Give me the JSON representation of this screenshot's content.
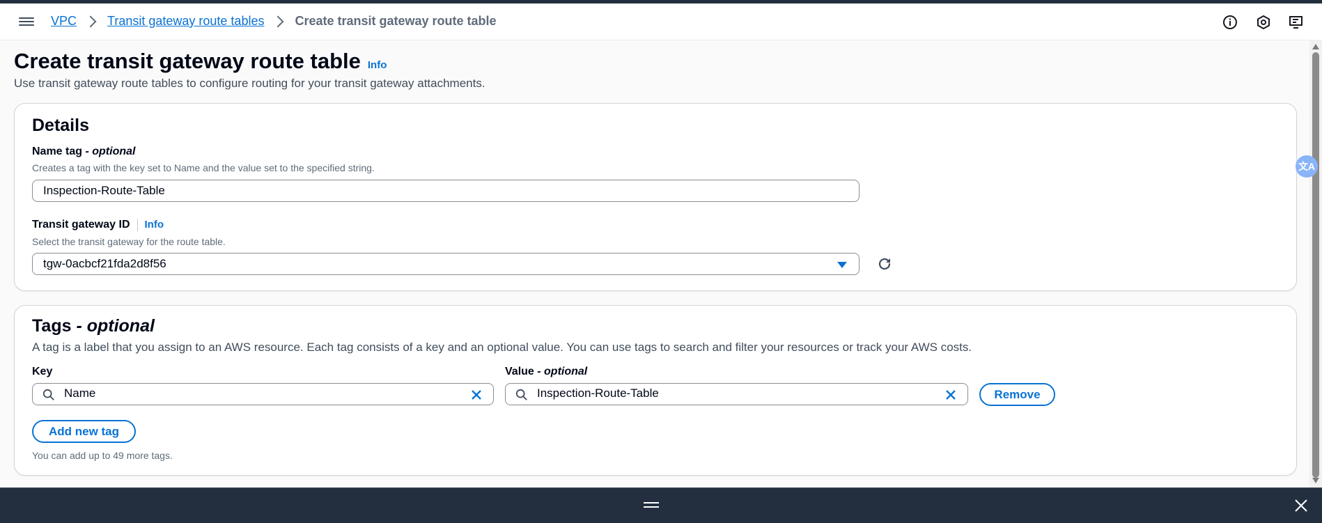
{
  "breadcrumbs": [
    {
      "label": "VPC"
    },
    {
      "label": "Transit gateway route tables"
    }
  ],
  "breadcrumb_current": "Create transit gateway route table",
  "page": {
    "title": "Create transit gateway route table",
    "info": "Info",
    "description": "Use transit gateway route tables to configure routing for your transit gateway attachments."
  },
  "details": {
    "title": "Details",
    "name_tag": {
      "label": "Name tag",
      "label_suffix": " - optional",
      "hint": "Creates a tag with the key set to Name and the value set to the specified string.",
      "value": "Inspection-Route-Table"
    },
    "transit_gateway": {
      "label": "Transit gateway ID",
      "info": "Info",
      "hint": "Select the transit gateway for the route table.",
      "value": "tgw-0acbcf21fda2d8f56"
    }
  },
  "tags": {
    "title": "Tags",
    "title_suffix": " - optional",
    "description": "A tag is a label that you assign to an AWS resource. Each tag consists of a key and an optional value. You can use tags to search and filter your resources or track your AWS costs.",
    "key_label": "Key",
    "value_label": "Value",
    "value_label_suffix": " - optional",
    "rows": [
      {
        "key": "Name",
        "value": "Inspection-Route-Table",
        "remove_label": "Remove"
      }
    ],
    "add_label": "Add new tag",
    "limit_text": "You can add up to 49 more tags."
  },
  "translate_label": "文A",
  "icons": {
    "header": [
      "info-icon",
      "settings-icon",
      "screen-feedback-icon"
    ],
    "refresh": "refresh-icon",
    "search": "search-icon",
    "clear": "clear-icon",
    "close": "close-icon"
  },
  "colors": {
    "accent": "#0972d3",
    "dark_bar": "#232f3e"
  }
}
